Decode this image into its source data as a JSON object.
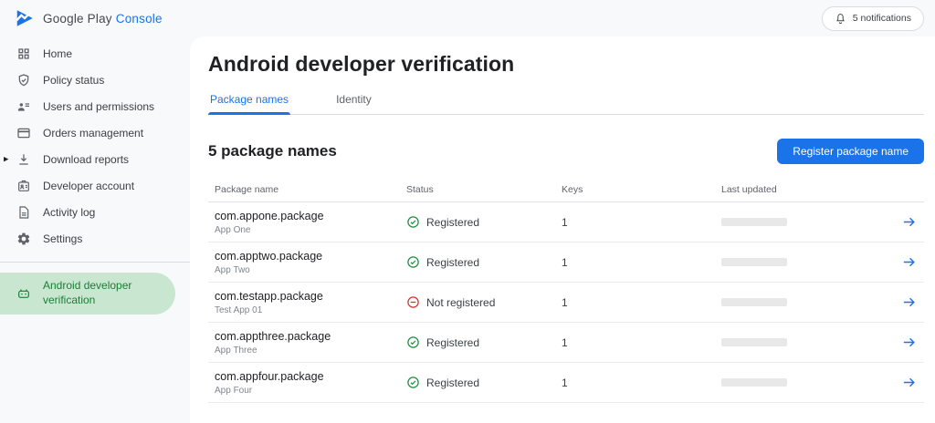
{
  "header": {
    "logo": {
      "google_play": "Google Play",
      "console": "Console"
    },
    "notifications": {
      "label": "5 notifications",
      "icon": "bell-icon"
    }
  },
  "sidebar": {
    "items": [
      {
        "label": "Home",
        "icon": "grid-icon",
        "selected": false
      },
      {
        "label": "Policy status",
        "icon": "shield-check-icon",
        "selected": false
      },
      {
        "label": "Users and permissions",
        "icon": "user-list-icon",
        "selected": false
      },
      {
        "label": "Orders management",
        "icon": "credit-card-icon",
        "selected": false
      },
      {
        "label": "Download reports",
        "icon": "download-icon",
        "expandable": true,
        "selected": false
      },
      {
        "label": "Developer account",
        "icon": "id-badge-icon",
        "selected": false
      },
      {
        "label": "Activity log",
        "icon": "document-icon",
        "selected": false
      },
      {
        "label": "Settings",
        "icon": "gear-icon",
        "selected": false
      },
      {
        "label": "Android developer verification",
        "icon": "android-icon",
        "selected": true
      }
    ]
  },
  "main": {
    "title": "Android developer verification",
    "tabs": [
      {
        "label": "Package names",
        "active": true
      },
      {
        "label": "Identity",
        "active": false
      }
    ],
    "section": {
      "heading": "5 package names",
      "register_button": "Register package name"
    },
    "table": {
      "columns": [
        "Package name",
        "Status",
        "Keys",
        "Last updated"
      ],
      "rows": [
        {
          "package": "com.appone.package",
          "app_name": "App One",
          "status": "Registered",
          "status_type": "registered",
          "keys": "1",
          "last_updated_redacted": true
        },
        {
          "package": "com.apptwo.package",
          "app_name": "App Two",
          "status": "Registered",
          "status_type": "registered",
          "keys": "1",
          "last_updated_redacted": true
        },
        {
          "package": "com.testapp.package",
          "app_name": "Test App 01",
          "status": "Not registered",
          "status_type": "not_registered",
          "keys": "1",
          "last_updated_redacted": true
        },
        {
          "package": "com.appthree.package",
          "app_name": "App Three",
          "status": "Registered",
          "status_type": "registered",
          "keys": "1",
          "last_updated_redacted": true
        },
        {
          "package": "com.appfour.package",
          "app_name": "App Four",
          "status": "Registered",
          "status_type": "registered",
          "keys": "1",
          "last_updated_redacted": true
        }
      ]
    }
  },
  "colors": {
    "accent_blue": "#1a73e8",
    "status_green": "#1e8e3e",
    "status_red": "#d93025",
    "selected_item_bg": "#c9e7d0",
    "selected_item_text": "#188038"
  }
}
